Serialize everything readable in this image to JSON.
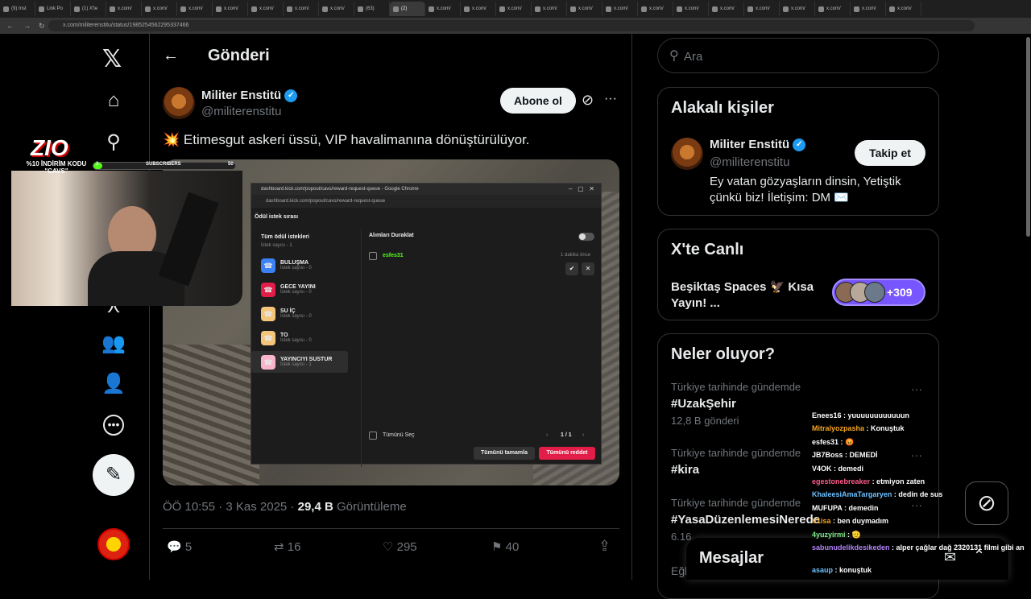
{
  "browser": {
    "tabs": [
      "(9) Inst",
      "Link Po",
      "(1) X'te",
      "x.com/",
      "x.com/",
      "x.com/",
      "x.com/",
      "x.com/",
      "x.com/",
      "x.com/",
      "(63)",
      "(2)",
      "x.com/",
      "x.com/",
      "x.com/",
      "x.com/",
      "x.com/",
      "x.com/",
      "x.com/",
      "x.com/",
      "x.com/",
      "x.com/",
      "x.com/",
      "x.com/",
      "x.com/",
      "x.com/"
    ],
    "url": "x.com/militerenstitu/status/1985254562295337466"
  },
  "header": {
    "title": "Gönderi",
    "back_icon": "arrow-left-icon"
  },
  "post": {
    "author_name": "Militer Enstitü",
    "author_handle": "@militerenstitu",
    "subscribe_label": "Abone ol",
    "text": "💥 Etimesgut askeri üssü, VIP havalimanına dönüştürülüyor.",
    "time": "ÖÖ 10:55 · 3 Kas 2025 ·",
    "views_count": "29,4 B",
    "views_label": "Görüntüleme",
    "replies": "5",
    "reposts": "16",
    "likes": "295",
    "bookmarks": "40"
  },
  "search": {
    "placeholder": "Ara"
  },
  "related": {
    "title": "Alakalı kişiler",
    "name": "Militer Enstitü",
    "handle": "@militerenstitu",
    "follow_label": "Takip et",
    "bio": "Ey vatan gözyaşların dinsin, Yetiştik çünkü biz! İletişim: DM ✉️"
  },
  "live": {
    "title": "X'te Canlı",
    "space_title": "Beşiktaş Spaces 🦅 Kısa Yayın! ...",
    "listeners": "+309"
  },
  "trends": {
    "title": "Neler oluyor?",
    "items": [
      {
        "context": "Türkiye tarihinde gündemde",
        "name": "#UzakŞehir",
        "count": "12,8 B gönderi"
      },
      {
        "context": "Türkiye tarihinde gündemde",
        "name": "#kira",
        "count": ""
      },
      {
        "context": "Türkiye tarihinde gündemde",
        "name": "#YasaDüzenlemesiNerede",
        "count": "6.16"
      }
    ],
    "partial": "Eğle"
  },
  "messages": {
    "title": "Mesajlar"
  },
  "stream": {
    "logo": "ZIO",
    "promo": "%10 İNDİRİM KODU \"CAVS\"",
    "subs_label": "SUBSCRIBERS",
    "subs_left": "3",
    "subs_right": "50"
  },
  "popup": {
    "window_title": "dashboard.kick.com/popout/cavs/reward-request-queue - Google Chrome",
    "url": "dashboard.kick.com/popout/cavs/reward-request-queue",
    "header": "Ödül istek sırası",
    "all_title": "Tüm ödül istekleri",
    "all_count": "İstek sayısı - 1",
    "rewards": [
      {
        "name": "BULUŞMA",
        "count": "İstek sayısı - 0",
        "color": "#3b82f6"
      },
      {
        "name": "GECE YAYINI",
        "count": "İstek sayısı - 0",
        "color": "#e11d48"
      },
      {
        "name": "SU İÇ",
        "count": "İstek sayısı - 0",
        "color": "#f5c67a"
      },
      {
        "name": "TO",
        "count": "İstek sayısı - 0",
        "color": "#f5c67a"
      },
      {
        "name": "YAYINCIYI SUSTUR",
        "count": "İstek sayısı - 1",
        "color": "#f8b4c8"
      }
    ],
    "pause_label": "Alımları Duraklat",
    "request_user": "esfes31",
    "request_time": "1 dakika önce",
    "select_all": "Tümünü Seç",
    "pager": "1 / 1",
    "complete_all": "Tümünü tamamla",
    "reject_all": "Tümünü reddet"
  },
  "chat": [
    {
      "user": "Enees16",
      "msg": ": yuuuuuuuuuuuun",
      "color": "#ffffff"
    },
    {
      "user": "Mitralyozpasha",
      "msg": ": Konuştuk",
      "color": "#f5a623"
    },
    {
      "user": "esfes31",
      "msg": ": 😡",
      "color": "#ffffff"
    },
    {
      "user": "JB7Boss",
      "msg": ": DEMEDİ",
      "color": "#ffffff"
    },
    {
      "user": "V4OK",
      "msg": ": demedi",
      "color": "#ffffff"
    },
    {
      "user": "egestonebreaker",
      "msg": ": etmiyon zaten",
      "color": "#ff5c8a"
    },
    {
      "user": "KhaleesiAmaTargaryen",
      "msg": ": dedin de sus",
      "color": "#6ec1ff"
    },
    {
      "user": "MUFUPA",
      "msg": ": demedin",
      "color": "#ffffff"
    },
    {
      "user": "V1isa",
      "msg": ": ben duymadım",
      "color": "#f5a623"
    },
    {
      "user": "4yuzyirmi",
      "msg": ": 🫡",
      "color": "#7ee787"
    },
    {
      "user": "sabunudelikdesikeden",
      "msg": ": alper çağlar dağ 2320131 filmi gibi an",
      "color": "#b084f5"
    },
    {
      "user": "asaup",
      "msg": ": konuştuk",
      "color": "#6ec1ff"
    }
  ]
}
